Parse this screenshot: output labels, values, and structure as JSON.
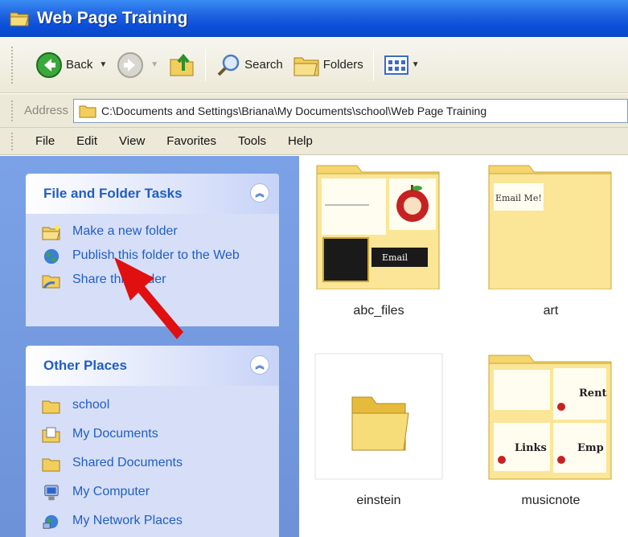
{
  "window": {
    "title": "Web Page Training"
  },
  "toolbar": {
    "back_label": "Back",
    "search_label": "Search",
    "folders_label": "Folders"
  },
  "address": {
    "label": "Address",
    "path": "C:\\Documents and Settings\\Briana\\My Documents\\school\\Web Page Training"
  },
  "menu": [
    "File",
    "Edit",
    "View",
    "Favorites",
    "Tools",
    "Help"
  ],
  "file_tasks": {
    "title": "File and Folder Tasks",
    "items": [
      {
        "label": "Make a new folder",
        "icon": "new-folder-icon"
      },
      {
        "label": "Publish this folder to the Web",
        "icon": "globe-icon"
      },
      {
        "label": "Share this folder",
        "icon": "share-folder-icon"
      }
    ]
  },
  "other_places": {
    "title": "Other Places",
    "items": [
      {
        "label": "school",
        "icon": "folder-icon"
      },
      {
        "label": "My Documents",
        "icon": "my-documents-icon"
      },
      {
        "label": "Shared Documents",
        "icon": "folder-icon"
      },
      {
        "label": "My Computer",
        "icon": "computer-icon"
      },
      {
        "label": "My Network Places",
        "icon": "network-icon"
      }
    ]
  },
  "folders": [
    {
      "name": "abc_files",
      "thumb_text": "Email"
    },
    {
      "name": "art",
      "thumb_text": "Email Me!"
    },
    {
      "name": "einstein"
    },
    {
      "name": "musicnote",
      "thumb_text": [
        "Rent",
        "Links",
        "Emp"
      ]
    }
  ],
  "colors": {
    "title_bar": "#0b4fd8",
    "task_pane": "#6e92d8",
    "link": "#215dc6",
    "arrow": "#e01010"
  }
}
